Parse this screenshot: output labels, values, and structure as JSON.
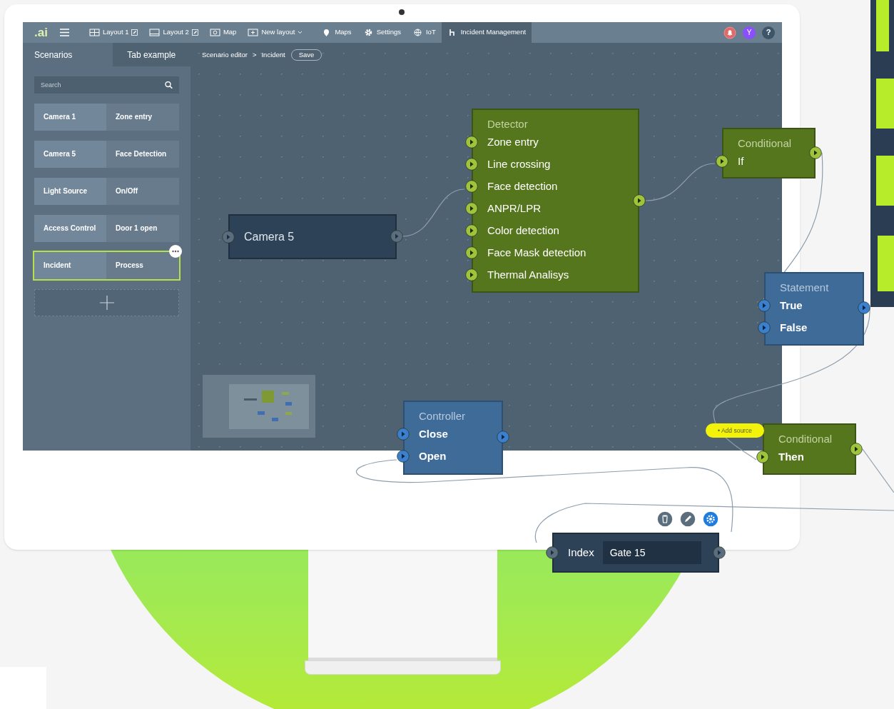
{
  "topbar": {
    "logo": ".ai",
    "items": [
      {
        "label": "Layout 1",
        "kind": "grid",
        "editable": true,
        "dropdown": false,
        "selected": false
      },
      {
        "label": "Layout 2",
        "kind": "rows",
        "editable": true,
        "dropdown": false,
        "selected": false
      },
      {
        "label": "Map",
        "kind": "map",
        "editable": false,
        "dropdown": false,
        "selected": false
      },
      {
        "label": "New layout",
        "kind": "add",
        "editable": false,
        "dropdown": true,
        "selected": false
      },
      {
        "label": "Maps",
        "kind": "pin",
        "editable": false,
        "dropdown": false,
        "selected": false
      },
      {
        "label": "Settings",
        "kind": "gear",
        "editable": false,
        "dropdown": false,
        "selected": false
      },
      {
        "label": "IoT",
        "kind": "globe",
        "editable": false,
        "dropdown": false,
        "selected": false
      },
      {
        "label": "Incident Management",
        "kind": "flow",
        "editable": false,
        "dropdown": false,
        "selected": true
      }
    ],
    "avatar": "Y",
    "help": "?"
  },
  "sidebar": {
    "tabs": [
      {
        "label": "Scenarios",
        "selected": true
      },
      {
        "label": "Tab example",
        "selected": false
      }
    ],
    "search": {
      "placeholder": "Search"
    },
    "scenarios": [
      {
        "source": "Camera 1",
        "action": "Zone entry",
        "selected": false
      },
      {
        "source": "Camera 5",
        "action": "Face Detection",
        "selected": false
      },
      {
        "source": "Light Source",
        "action": "On/Off",
        "selected": false
      },
      {
        "source": "Access Control",
        "action": "Door 1 open",
        "selected": false
      },
      {
        "source": "Incident",
        "action": "Process",
        "selected": true
      }
    ]
  },
  "breadcrumb": {
    "items": [
      "Scenario editor",
      "Incident"
    ],
    "separator": ">",
    "save": "Save"
  },
  "nodes": [
    {
      "kind": "device",
      "title": "Camera 5",
      "input": true,
      "output": true
    },
    {
      "kind": "logic",
      "title": "Detector",
      "input": false,
      "output": true,
      "ports": [
        "Zone entry",
        "Line crossing",
        "Face detection",
        "ANPR/LPR",
        "Color detection",
        "Face Mask detection",
        "Thermal Analisys"
      ]
    },
    {
      "kind": "logic",
      "title": "Conditional",
      "input": false,
      "output": true,
      "ports": [
        "If"
      ]
    },
    {
      "kind": "action",
      "title": "Statement",
      "input": false,
      "output": true,
      "ports": [
        "True",
        "False"
      ]
    },
    {
      "kind": "action",
      "title": "Controller",
      "input": false,
      "output": true,
      "ports": [
        "Close",
        "Open"
      ]
    },
    {
      "kind": "logic",
      "title": "Conditional",
      "input": false,
      "output": true,
      "ports": [
        "Then"
      ]
    }
  ],
  "add_source": "• Add source",
  "index_node": {
    "label": "Index",
    "value": "Gate 15"
  }
}
